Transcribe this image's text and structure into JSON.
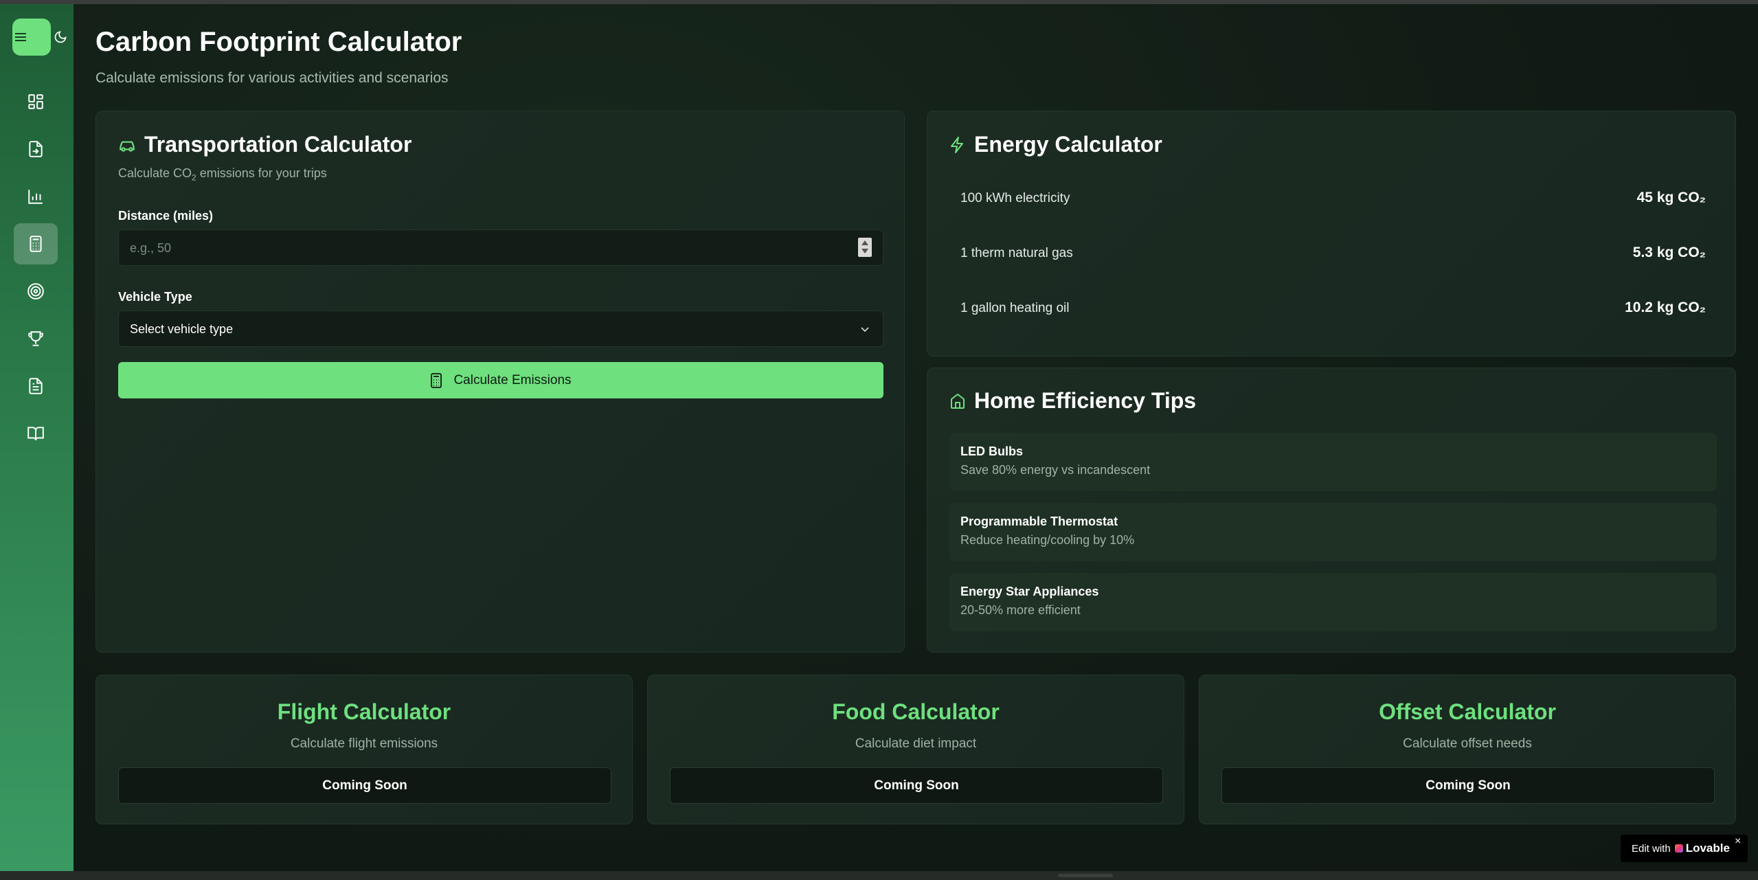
{
  "page": {
    "title": "Carbon Footprint Calculator",
    "subtitle": "Calculate emissions for various activities and scenarios"
  },
  "sidebar": {
    "items": [
      {
        "name": "dashboard",
        "icon": "dashboard-grid-icon",
        "active": false
      },
      {
        "name": "data-entry",
        "icon": "file-input-icon",
        "active": false
      },
      {
        "name": "analytics",
        "icon": "bar-chart-icon",
        "active": false
      },
      {
        "name": "calculator",
        "icon": "calculator-icon",
        "active": true
      },
      {
        "name": "goals",
        "icon": "target-icon",
        "active": false
      },
      {
        "name": "achievements",
        "icon": "trophy-icon",
        "active": false
      },
      {
        "name": "reports",
        "icon": "document-icon",
        "active": false
      },
      {
        "name": "learn",
        "icon": "book-open-icon",
        "active": false
      }
    ]
  },
  "transport": {
    "title": "Transportation Calculator",
    "desc_prefix": "Calculate CO",
    "desc_sub": "2",
    "desc_suffix": " emissions for your trips",
    "distance_label": "Distance (miles)",
    "distance_placeholder": "e.g., 50",
    "vehicle_label": "Vehicle Type",
    "vehicle_value": "Select vehicle type",
    "button_label": "Calculate Emissions"
  },
  "energy": {
    "title": "Energy Calculator",
    "rows": [
      {
        "label": "100 kWh electricity",
        "amount": "45 kg CO₂"
      },
      {
        "label": "1 therm natural gas",
        "amount": "5.3 kg CO₂"
      },
      {
        "label": "1 gallon heating oil",
        "amount": "10.2 kg CO₂"
      }
    ]
  },
  "tips": {
    "title": "Home Efficiency Tips",
    "items": [
      {
        "title": "LED Bulbs",
        "desc": "Save 80% energy vs incandescent"
      },
      {
        "title": "Programmable Thermostat",
        "desc": "Reduce heating/cooling by 10%"
      },
      {
        "title": "Energy Star Appliances",
        "desc": "20-50% more efficient"
      }
    ]
  },
  "mini_cards": [
    {
      "title": "Flight Calculator",
      "desc": "Calculate flight emissions",
      "button": "Coming Soon"
    },
    {
      "title": "Food Calculator",
      "desc": "Calculate diet impact",
      "button": "Coming Soon"
    },
    {
      "title": "Offset Calculator",
      "desc": "Calculate offset needs",
      "button": "Coming Soon"
    }
  ],
  "badge": {
    "prefix": "Edit with",
    "brand": "Lovable",
    "close": "×"
  },
  "colors": {
    "accent": "#6ee07e",
    "background": "#0f1a13",
    "card": "#1c2c22"
  }
}
